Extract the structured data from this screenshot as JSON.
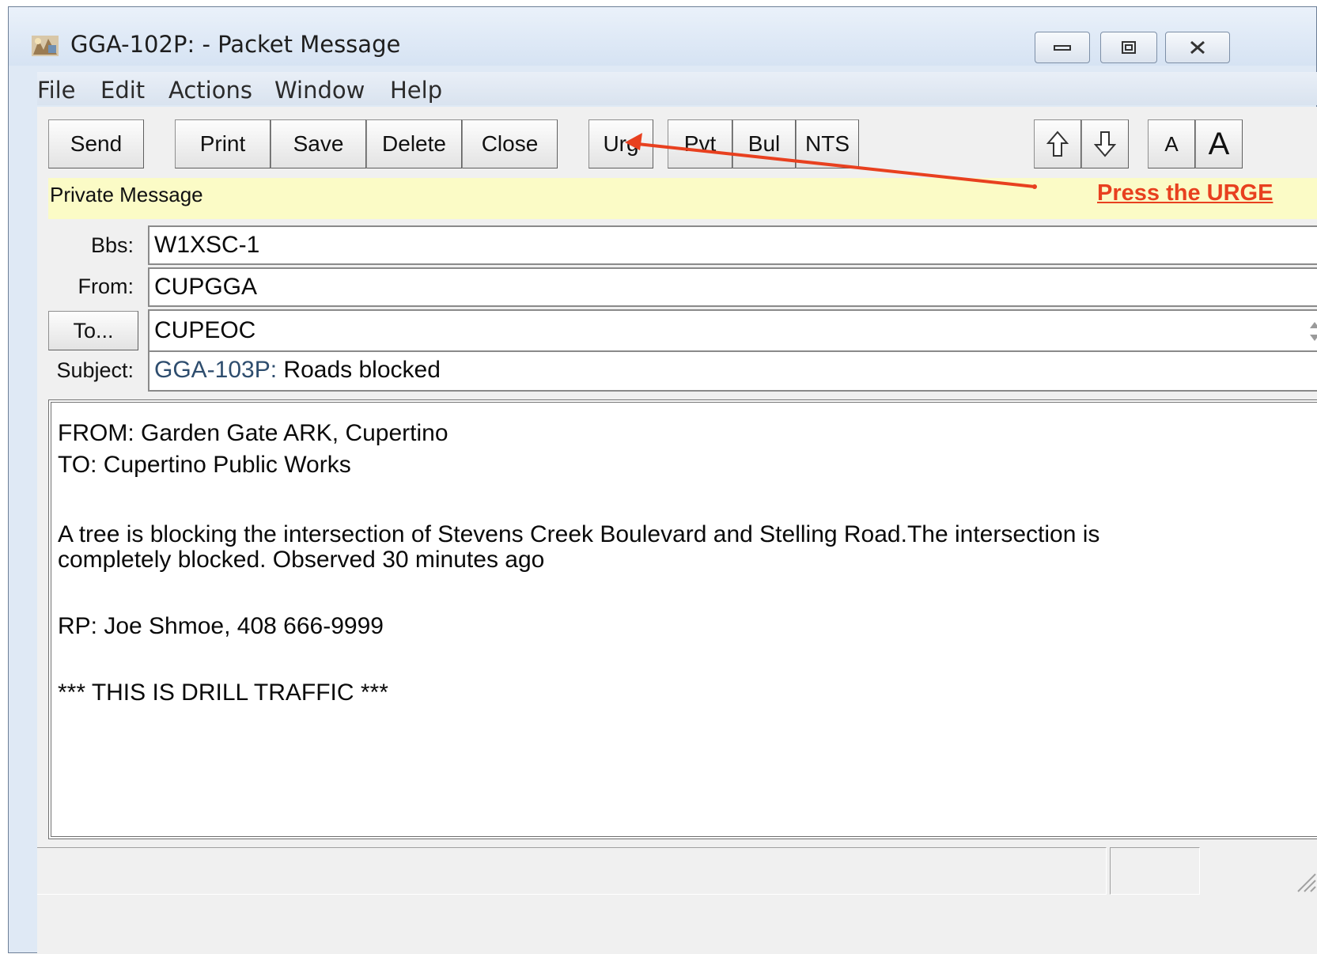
{
  "window": {
    "title": "GGA-102P:  - Packet Message",
    "icon": "packet-app-icon"
  },
  "caption_buttons": {
    "minimize": "minimize-icon",
    "maximize": "maximize-icon",
    "close": "close-icon"
  },
  "menu": {
    "items": [
      "File",
      "Edit",
      "Actions",
      "Window",
      "Help"
    ]
  },
  "toolbar": {
    "send": "Send",
    "print": "Print",
    "save": "Save",
    "delete": "Delete",
    "close": "Close",
    "urg": "Urg",
    "pvt": "Pvt",
    "bul": "Bul",
    "nts": "NTS",
    "up_icon": "arrow-up-icon",
    "down_icon": "arrow-down-icon",
    "font_small": "A",
    "font_large": "A"
  },
  "info_strip": {
    "text": "Private Message",
    "color": "#fbfbc6"
  },
  "fields": {
    "bbs_label": "Bbs:",
    "bbs_value": "W1XSC-1",
    "from_label": "From:",
    "from_value": "CUPGGA",
    "to_button": "To...",
    "to_value": "CUPEOC",
    "subject_label": "Subject:",
    "subject_prefix": "GGA-103P:",
    "subject_value": "Roads blocked"
  },
  "message_body": {
    "lines": [
      "FROM:  Garden Gate ARK, Cupertino",
      "TO:  Cupertino Public Works",
      "A tree is blocking the intersection of Stevens Creek Boulevard and Stelling Road.The intersection is",
      "completely blocked. Observed 30 minutes ago",
      "RP:  Joe Shmoe, 408 666-9999",
      "*** THIS IS DRILL TRAFFIC ***"
    ]
  },
  "annotation": {
    "text": "Press the URGE",
    "color": "#e8401f"
  }
}
